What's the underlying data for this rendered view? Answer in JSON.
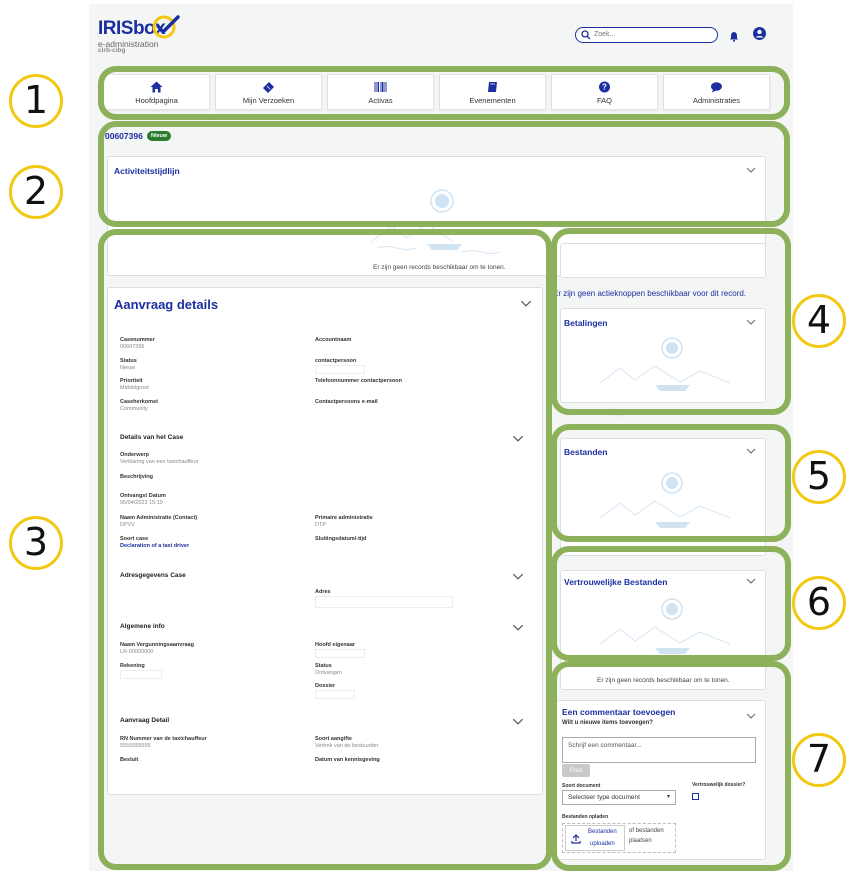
{
  "app": {
    "logo_title": "IRISbox",
    "logo_subtitle": "e-administration",
    "logo_subtitle2": "cirb-cibg",
    "search_placeholder": "Zoek..."
  },
  "nav": {
    "items": [
      {
        "label": "Hoofdpagina",
        "icon": "home-icon"
      },
      {
        "label": "Mijn Verzoeken",
        "icon": "ticket-icon"
      },
      {
        "label": "Activas",
        "icon": "barcode-icon"
      },
      {
        "label": "Evenementen",
        "icon": "book-icon"
      },
      {
        "label": "FAQ",
        "icon": "question-icon"
      },
      {
        "label": "Administraties",
        "icon": "chat-icon"
      }
    ]
  },
  "case": {
    "id": "00607396",
    "status_badge": "Nieuw"
  },
  "timeline": {
    "title": "Activiteitstijdlijn",
    "empty_message": "Er zijn geen records beschikbaar om te tonen."
  },
  "details": {
    "title": "Aanvraag details",
    "fields": {
      "casenummer_label": "Casenummer",
      "casenummer_value": "00607396",
      "accountnaam_label": "Accountnaam",
      "status_label": "Status",
      "status_value": "Nieuw",
      "contactpersoon_label": "contactpersoon",
      "prioriteit_label": "Prioriteit",
      "prioriteit_value": "Middelgroot",
      "telefoon_label": "Telefoonnummer contactpersoon",
      "caseherkomst_label": "Caseherkomst",
      "caseherkomst_value": "Community",
      "email_label": "Contactpersoons e-mail"
    },
    "case_section": {
      "title": "Details van het Case",
      "onderwerp_label": "Onderwerp",
      "onderwerp_value": "Verklaring van een taxichauffeur",
      "beschrijving_label": "Beschrijving",
      "ontvangst_label": "Ontvangst Datum",
      "ontvangst_value": "05/04/2023 15:19",
      "admin_label": "Naam Administratie (Contact)",
      "admin_value": "DPVV",
      "primaire_label": "Primaire administratie",
      "primaire_value": "DTP",
      "soort_label": "Soort case",
      "soort_value": "Declaration of a taxi driver",
      "sluiting_label": "Sluitingsdatum/-tijd"
    },
    "address_section": {
      "title": "Adresgegevens Case",
      "adres_label": "Adres"
    },
    "general_section": {
      "title": "Algemene info",
      "vergunning_label": "Naam Vergunningsaanvraag",
      "vergunning_value": "LR-00000000",
      "eigenaar_label": "Hoofd eigenaar",
      "rekening_label": "Rekening",
      "status_label": "Status",
      "status_value": "Ontvangen",
      "dossier_label": "Dossier"
    },
    "request_section": {
      "title": "Aanvraag Detail",
      "rn_label": "RN Nummer van de taxichauffeur",
      "rn_value": "5555555555",
      "aangifte_label": "Soort aangifte",
      "aangifte_value": "Vertrek van de bestuurder",
      "besluit_label": "Besluit",
      "kennisgeving_label": "Datum van kennisgeving"
    }
  },
  "actions_message": "Er zijn geen actieknoppen beschikbaar voor dit record.",
  "payments": {
    "title": "Betalingen",
    "empty_message": "Er zijn geen records beschikbaar om te tonen."
  },
  "files": {
    "title": "Bestanden"
  },
  "confidential_files": {
    "title": "Vertrouwelijke Bestanden",
    "empty_message": "Er zijn geen records beschikbaar om te tonen."
  },
  "comment": {
    "title": "Een commentaar toevoegen",
    "subtitle": "Wilt u nieuwe items toevoegen?",
    "placeholder": "Schrijf een commentaar...",
    "post_label": "Post",
    "doc_type_label": "Soort document",
    "doc_type_value": "Selecteer type document",
    "confidential_label": "Vertrouwelijk dossier?",
    "upload_label": "Bestanden opladen",
    "upload_button_line1": "Bestanden",
    "upload_button_line2": "uploaden",
    "upload_hint_line1": "of bestanden",
    "upload_hint_line2": "plaatsen"
  },
  "callouts": [
    "1",
    "2",
    "3",
    "4",
    "5",
    "6",
    "7"
  ],
  "colors": {
    "brand_blue": "#1b2fa0",
    "callout_green": "#8db05a",
    "number_ring_yellow": "#f2c811",
    "badge_green": "#2a7d2e"
  }
}
